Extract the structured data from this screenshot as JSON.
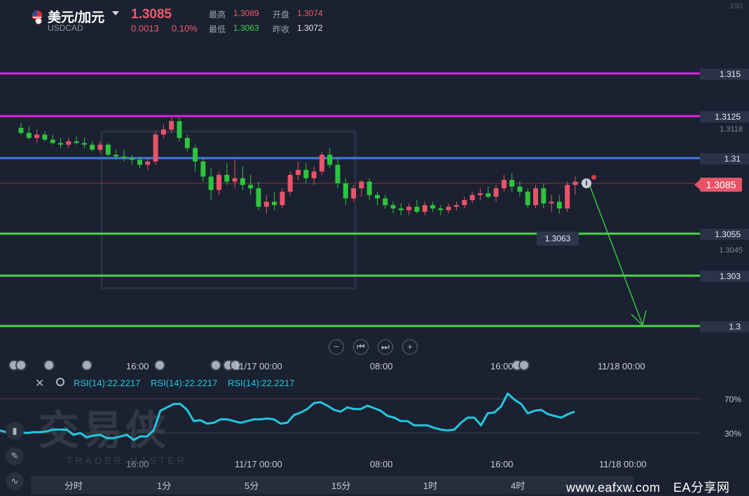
{
  "header": {
    "pair_name": "美元/加元",
    "pair_code": "USDCAD",
    "price": "1.3085",
    "change_abs": "0.0013",
    "change_pct": "0.10%",
    "high_label": "最高",
    "high_value": "1.3089",
    "open_label": "开盘",
    "open_value": "1.3074",
    "low_label": "最低",
    "low_value": "1.3063",
    "prev_label": "昨收",
    "prev_value": "1.3072",
    "corner_partial": "190"
  },
  "levels": {
    "l1315": "1.315",
    "l13125": "1.3125",
    "l131": "1.31",
    "l13055": "1.3055",
    "l1303": "1.303",
    "l13": "1.3",
    "g3118": "1.3118",
    "g3045": "1.3045",
    "current": "1.3085",
    "low_tag": "1.3063"
  },
  "colors": {
    "magenta": "#e020e0",
    "blue": "#3f7de0",
    "green": "#45d64a",
    "up": "#e8546a",
    "down": "#2ec43e",
    "rsi": "#22c7e0"
  },
  "icons": {
    "info": "i"
  },
  "controls": {
    "zoom_out": "−",
    "prev": "⏮",
    "next": "⏭",
    "zoom_in": "+"
  },
  "axis": {
    "t1": "16:00",
    "t2": "11/17 00:00",
    "t3": "08:00",
    "t4": "16:00",
    "t5": "11/18 00:00"
  },
  "rsi": {
    "label1": "RSI(14):22.2217",
    "label2": "RSI(14):22.2217",
    "label3": "RSI(14):22.2217",
    "level70": "70%",
    "level30": "30%",
    "close_icon": "✕"
  },
  "watermark": {
    "main": "交易侠",
    "sub": "TRADER MASTER"
  },
  "timeframes": [
    "分时",
    "1分",
    "5分",
    "15分",
    "1时",
    "4时"
  ],
  "site": "www.eafxw.com　EA分享网",
  "chart_data": {
    "type": "candlestick",
    "symbol": "USDCAD",
    "horizontal_levels": [
      1.315,
      1.3125,
      1.31,
      1.3055,
      1.303,
      1.3
    ],
    "grid_labels": [
      1.3118,
      1.3045
    ],
    "current_price": 1.3085,
    "period_low": 1.3063,
    "x_tick_labels": [
      "16:00",
      "11/17 00:00",
      "08:00",
      "16:00",
      "11/18 00:00"
    ],
    "ohlc": [
      [
        1.3118,
        1.3121,
        1.3114,
        1.3115
      ],
      [
        1.3115,
        1.3119,
        1.3111,
        1.3112
      ],
      [
        1.3112,
        1.3117,
        1.3109,
        1.3114
      ],
      [
        1.3114,
        1.3116,
        1.311,
        1.3111
      ],
      [
        1.3111,
        1.3114,
        1.3108,
        1.3109
      ],
      [
        1.3109,
        1.3112,
        1.3106,
        1.3108
      ],
      [
        1.3108,
        1.3112,
        1.3106,
        1.311
      ],
      [
        1.311,
        1.3113,
        1.3108,
        1.3109
      ],
      [
        1.3109,
        1.3112,
        1.3106,
        1.3108
      ],
      [
        1.3108,
        1.311,
        1.3104,
        1.3105
      ],
      [
        1.3105,
        1.311,
        1.3103,
        1.3108
      ],
      [
        1.3108,
        1.3109,
        1.3101,
        1.3102
      ],
      [
        1.3102,
        1.3105,
        1.3099,
        1.3101
      ],
      [
        1.3101,
        1.3105,
        1.3098,
        1.31
      ],
      [
        1.31,
        1.3102,
        1.3096,
        1.3099
      ],
      [
        1.3099,
        1.3101,
        1.3094,
        1.3096
      ],
      [
        1.3096,
        1.31,
        1.3093,
        1.3098
      ],
      [
        1.3098,
        1.3116,
        1.3096,
        1.3114
      ],
      [
        1.3114,
        1.312,
        1.3112,
        1.3117
      ],
      [
        1.3117,
        1.3124,
        1.3115,
        1.3122
      ],
      [
        1.3122,
        1.3124,
        1.311,
        1.3112
      ],
      [
        1.3112,
        1.3114,
        1.3104,
        1.3106
      ],
      [
        1.3106,
        1.3108,
        1.3092,
        1.3098
      ],
      [
        1.3098,
        1.31,
        1.3086,
        1.3089
      ],
      [
        1.3089,
        1.3094,
        1.3075,
        1.3081
      ],
      [
        1.3081,
        1.3092,
        1.3078,
        1.309
      ],
      [
        1.309,
        1.3097,
        1.3084,
        1.3086
      ],
      [
        1.3086,
        1.3099,
        1.3082,
        1.3088
      ],
      [
        1.3088,
        1.3095,
        1.3081,
        1.3084
      ],
      [
        1.3084,
        1.309,
        1.3078,
        1.3082
      ],
      [
        1.3082,
        1.3086,
        1.3069,
        1.3071
      ],
      [
        1.3071,
        1.3078,
        1.3067,
        1.3074
      ],
      [
        1.3074,
        1.308,
        1.3069,
        1.3072
      ],
      [
        1.3072,
        1.3082,
        1.307,
        1.308
      ],
      [
        1.308,
        1.3092,
        1.3078,
        1.309
      ],
      [
        1.309,
        1.3098,
        1.3087,
        1.3093
      ],
      [
        1.3093,
        1.3097,
        1.3085,
        1.3088
      ],
      [
        1.3088,
        1.3095,
        1.3084,
        1.3092
      ],
      [
        1.3092,
        1.3104,
        1.309,
        1.3102
      ],
      [
        1.3102,
        1.3106,
        1.3094,
        1.3096
      ],
      [
        1.3096,
        1.31,
        1.3082,
        1.3085
      ],
      [
        1.3085,
        1.3088,
        1.3072,
        1.3076
      ],
      [
        1.3076,
        1.3084,
        1.3074,
        1.3082
      ],
      [
        1.3082,
        1.3087,
        1.3077,
        1.3086
      ],
      [
        1.3086,
        1.3088,
        1.3075,
        1.3078
      ],
      [
        1.3078,
        1.308,
        1.3072,
        1.3076
      ],
      [
        1.3076,
        1.3078,
        1.307,
        1.3072
      ],
      [
        1.3072,
        1.3074,
        1.3067,
        1.307
      ],
      [
        1.307,
        1.3073,
        1.3066,
        1.3069
      ],
      [
        1.3069,
        1.3073,
        1.3066,
        1.3071
      ],
      [
        1.3071,
        1.3075,
        1.3067,
        1.3068
      ],
      [
        1.3068,
        1.3074,
        1.3066,
        1.3072
      ],
      [
        1.3072,
        1.3074,
        1.3068,
        1.307
      ],
      [
        1.307,
        1.3072,
        1.3066,
        1.3069
      ],
      [
        1.3069,
        1.3073,
        1.3067,
        1.3071
      ],
      [
        1.3071,
        1.3074,
        1.3069,
        1.3072
      ],
      [
        1.3072,
        1.3077,
        1.307,
        1.3075
      ],
      [
        1.3075,
        1.308,
        1.3073,
        1.3078
      ],
      [
        1.3078,
        1.3082,
        1.3075,
        1.3079
      ],
      [
        1.3079,
        1.3083,
        1.3076,
        1.3077
      ],
      [
        1.3077,
        1.3084,
        1.3074,
        1.3082
      ],
      [
        1.3082,
        1.309,
        1.308,
        1.3087
      ],
      [
        1.3087,
        1.3091,
        1.308,
        1.3083
      ],
      [
        1.3083,
        1.3086,
        1.3077,
        1.308
      ],
      [
        1.308,
        1.3082,
        1.307,
        1.3072
      ],
      [
        1.3072,
        1.3084,
        1.307,
        1.3082
      ],
      [
        1.3082,
        1.3085,
        1.307,
        1.3073
      ],
      [
        1.3073,
        1.3078,
        1.3068,
        1.3074
      ],
      [
        1.3074,
        1.3078,
        1.3067,
        1.307
      ],
      [
        1.307,
        1.3086,
        1.3068,
        1.3084
      ],
      [
        1.3084,
        1.3089,
        1.3078,
        1.3086
      ]
    ],
    "rsi": {
      "name": "RSI(14)",
      "last": 22.2217,
      "levels": [
        70,
        30
      ],
      "values": [
        33,
        31,
        32,
        31,
        30,
        31,
        31,
        32,
        34,
        34,
        34,
        28,
        30,
        25,
        27,
        28,
        24,
        24,
        26,
        28,
        22,
        26,
        26,
        33,
        56,
        60,
        64,
        64,
        57,
        44,
        45,
        41,
        42,
        46,
        46,
        44,
        42,
        44,
        46,
        46,
        47,
        46,
        41,
        42,
        51,
        54,
        58,
        65,
        66,
        62,
        57,
        55,
        60,
        58,
        58,
        62,
        59,
        56,
        50,
        48,
        44,
        44,
        39,
        39,
        39,
        36,
        34,
        33,
        34,
        42,
        48,
        48,
        39,
        53,
        54,
        61,
        76,
        69,
        64,
        53,
        56,
        57,
        52,
        50,
        48,
        52,
        55
      ]
    }
  }
}
